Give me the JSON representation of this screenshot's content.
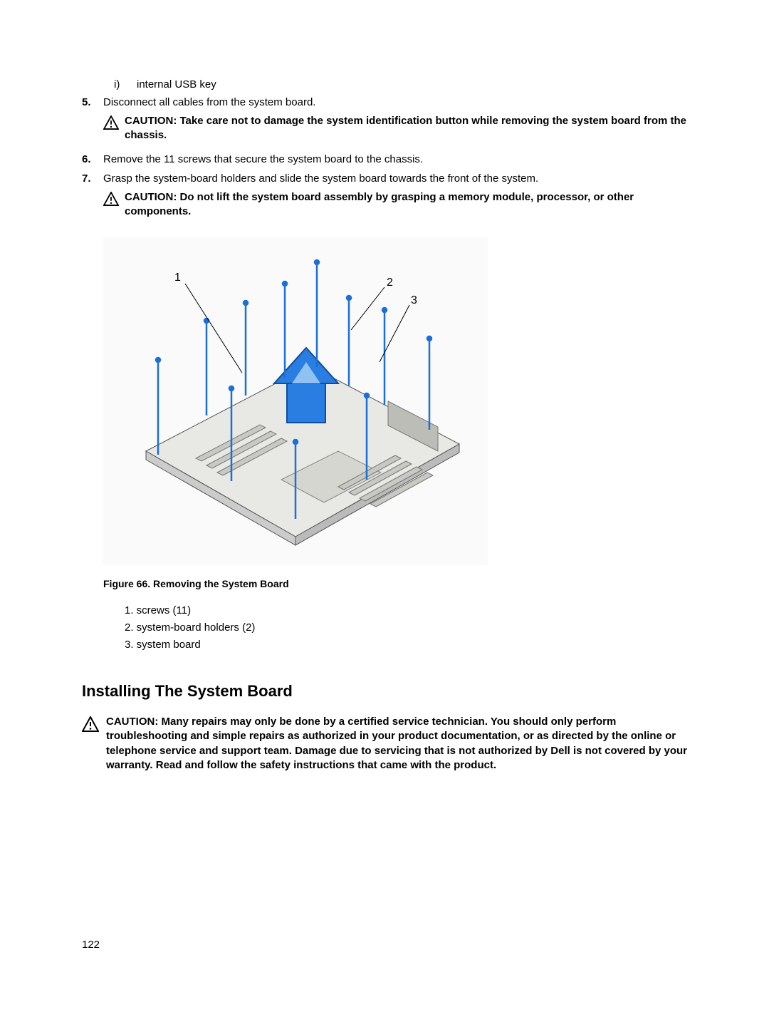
{
  "sublist": {
    "marker": "i)",
    "text": "internal USB key"
  },
  "steps": {
    "s5": {
      "num": "5.",
      "text": "Disconnect all cables from the system board."
    },
    "s6": {
      "num": "6.",
      "text": "Remove the 11 screws that secure the system board to the chassis."
    },
    "s7": {
      "num": "7.",
      "text": "Grasp the system-board holders and slide the system board towards the front of the system."
    }
  },
  "caution1": "CAUTION: Take care not to damage the system identification button while removing the system board from the chassis.",
  "caution2": "CAUTION: Do not lift the system board assembly by grasping a memory module, processor, or other components.",
  "figure": {
    "callout1": "1",
    "callout2": "2",
    "callout3": "3",
    "caption": "Figure 66. Removing the System Board",
    "legend1": "1. screws (11)",
    "legend2": "2. system-board holders (2)",
    "legend3": "3. system board"
  },
  "heading": "Installing The System Board",
  "caution3": "CAUTION: Many repairs may only be done by a certified service technician. You should only perform troubleshooting and simple repairs as authorized in your product documentation, or as directed by the online or telephone service and support team. Damage due to servicing that is not authorized by Dell is not covered by your warranty. Read and follow the safety instructions that came with the product.",
  "pageNumber": "122"
}
